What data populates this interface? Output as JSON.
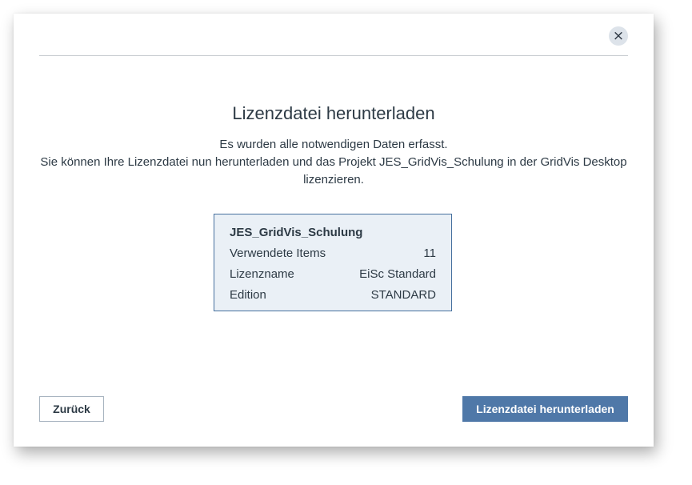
{
  "dialog": {
    "close_label": "×",
    "title": "Lizenzdatei herunterladen",
    "description_lines": [
      "Es wurden alle notwendigen Daten erfasst.",
      "Sie können Ihre Lizenzdatei nun herunterladen und das Projekt JES_GridVis_Schulung in der GridVis Desktop",
      "lizenzieren."
    ],
    "info": {
      "project_name": "JES_GridVis_Schulung",
      "rows": [
        {
          "label": "Verwendete Items",
          "value": "11"
        },
        {
          "label": "Lizenzname",
          "value": "EiSc Standard"
        },
        {
          "label": "Edition",
          "value": "STANDARD"
        }
      ]
    },
    "buttons": {
      "back_label": "Zurück",
      "download_label": "Lizenzdatei herunterladen"
    }
  },
  "colors": {
    "primary": "#4f78a8",
    "info_border": "#46709e",
    "info_bg": "#eaf0f6"
  },
  "icons": {
    "close": "close-icon"
  }
}
